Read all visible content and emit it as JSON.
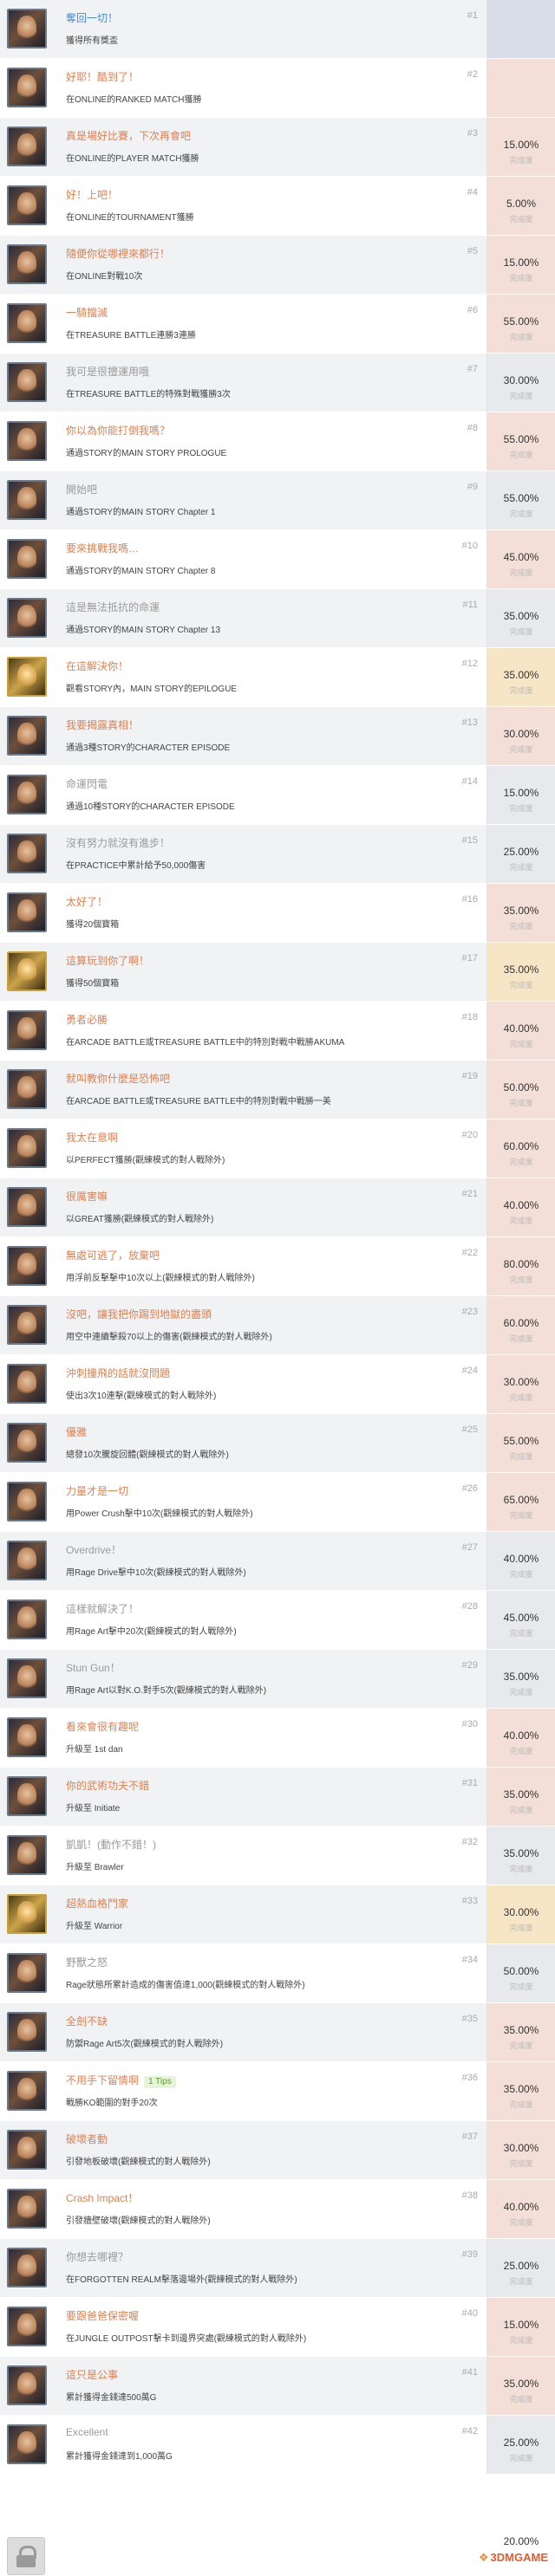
{
  "achievements": [
    {
      "num": "#1",
      "title": "奪回一切！",
      "desc": "獲得所有獎盃",
      "pct": "",
      "lbl": "",
      "tcls": "blue",
      "pcls": "c-blue",
      "gold": false
    },
    {
      "num": "#2",
      "title": "好耶！酷到了！",
      "desc": "在ONLINE的RANKED MATCH獲勝",
      "pct": "",
      "lbl": "",
      "tcls": "",
      "pcls": "c-pink",
      "gold": false
    },
    {
      "num": "#3",
      "title": "真是場好比賽，下次再會吧",
      "desc": "在ONLINE的PLAYER MATCH獲勝",
      "pct": "15.00%",
      "lbl": "完成度",
      "tcls": "",
      "pcls": "c-pink",
      "gold": false
    },
    {
      "num": "#4",
      "title": "好！上吧！",
      "desc": "在ONLINE的TOURNAMENT獲勝",
      "pct": "5.00%",
      "lbl": "完成度",
      "tcls": "",
      "pcls": "c-pink",
      "gold": false
    },
    {
      "num": "#5",
      "title": "隨便你從哪裡來都行！",
      "desc": "在ONLINE對戰10次",
      "pct": "15.00%",
      "lbl": "完成度",
      "tcls": "",
      "pcls": "c-pink",
      "gold": false
    },
    {
      "num": "#6",
      "title": "一騎擋滅",
      "desc": "在TREASURE BATTLE連勝3連勝",
      "pct": "55.00%",
      "lbl": "完成度",
      "tcls": "",
      "pcls": "c-pink",
      "gold": false
    },
    {
      "num": "#7",
      "title": "我可是很擅運用哦",
      "desc": "在TREASURE BATTLE的特殊對戰獲勝3次",
      "pct": "30.00%",
      "lbl": "完成度",
      "tcls": "gray",
      "pcls": "c-gray",
      "gold": false
    },
    {
      "num": "#8",
      "title": "你以為你能打倒我嗎？",
      "desc": "通過STORY的MAIN STORY PROLOGUE",
      "pct": "55.00%",
      "lbl": "完成度",
      "tcls": "",
      "pcls": "c-pink",
      "gold": false
    },
    {
      "num": "#9",
      "title": "開始吧",
      "desc": "通過STORY的MAIN STORY Chapter 1",
      "pct": "55.00%",
      "lbl": "完成度",
      "tcls": "gray",
      "pcls": "c-gray",
      "gold": false
    },
    {
      "num": "#10",
      "title": "要來挑戰我嗎…",
      "desc": "通過STORY的MAIN STORY Chapter 8",
      "pct": "45.00%",
      "lbl": "完成度",
      "tcls": "",
      "pcls": "c-pink",
      "gold": false
    },
    {
      "num": "#11",
      "title": "這是無法抵抗的命運",
      "desc": "通過STORY的MAIN STORY Chapter 13",
      "pct": "35.00%",
      "lbl": "完成度",
      "tcls": "gray",
      "pcls": "c-gray",
      "gold": false
    },
    {
      "num": "#12",
      "title": "在這解決你！",
      "desc": "觀看STORY內，MAIN STORY的EPILOGUE",
      "pct": "35.00%",
      "lbl": "完成度",
      "tcls": "",
      "pcls": "c-cream",
      "gold": true
    },
    {
      "num": "#13",
      "title": "我要揭露真相！",
      "desc": "通過3種STORY的CHARACTER EPISODE",
      "pct": "30.00%",
      "lbl": "完成度",
      "tcls": "",
      "pcls": "c-pink",
      "gold": false
    },
    {
      "num": "#14",
      "title": "命運閃電",
      "desc": "通過10種STORY的CHARACTER EPISODE",
      "pct": "15.00%",
      "lbl": "完成度",
      "tcls": "gray",
      "pcls": "c-gray",
      "gold": false
    },
    {
      "num": "#15",
      "title": "沒有努力就沒有進步！",
      "desc": "在PRACTICE中累計給予50,000傷害",
      "pct": "25.00%",
      "lbl": "完成度",
      "tcls": "gray",
      "pcls": "c-gray",
      "gold": false
    },
    {
      "num": "#16",
      "title": "太好了！",
      "desc": "獲得20個寶箱",
      "pct": "35.00%",
      "lbl": "完成度",
      "tcls": "",
      "pcls": "c-pink",
      "gold": false
    },
    {
      "num": "#17",
      "title": "這算玩到你了啊！",
      "desc": "獲得50個寶箱",
      "pct": "35.00%",
      "lbl": "完成度",
      "tcls": "",
      "pcls": "c-cream",
      "gold": true
    },
    {
      "num": "#18",
      "title": "勇者必勝",
      "desc": "在ARCADE BATTLE或TREASURE BATTLE中的特別對戰中戰勝AKUMA",
      "pct": "40.00%",
      "lbl": "完成度",
      "tcls": "",
      "pcls": "c-pink",
      "gold": false
    },
    {
      "num": "#19",
      "title": "就叫教你什麼是恐怖吧",
      "desc": "在ARCADE BATTLE或TREASURE BATTLE中的特別對戰中戰勝一美",
      "pct": "50.00%",
      "lbl": "完成度",
      "tcls": "",
      "pcls": "c-pink",
      "gold": false
    },
    {
      "num": "#20",
      "title": "我太在意啊",
      "desc": "以PERFECT獲勝(觀練模式的對人戰除外)",
      "pct": "60.00%",
      "lbl": "完成度",
      "tcls": "",
      "pcls": "c-pink",
      "gold": false
    },
    {
      "num": "#21",
      "title": "很厲害嘛",
      "desc": "以GREAT獲勝(觀練模式的對人戰除外)",
      "pct": "40.00%",
      "lbl": "完成度",
      "tcls": "",
      "pcls": "c-pink",
      "gold": false
    },
    {
      "num": "#22",
      "title": "無處可逃了，放棄吧",
      "desc": "用浮前反擊擊中10次以上(觀練模式的對人戰除外)",
      "pct": "80.00%",
      "lbl": "完成度",
      "tcls": "",
      "pcls": "c-pink",
      "gold": false
    },
    {
      "num": "#23",
      "title": "沒吧，讓我把你踢到地獄的盡頭",
      "desc": "用空中連續擊殺70以上的傷害(觀練模式的對人戰除外)",
      "pct": "60.00%",
      "lbl": "完成度",
      "tcls": "",
      "pcls": "c-pink",
      "gold": false
    },
    {
      "num": "#24",
      "title": "沖刺撞飛的話就沒問題",
      "desc": "使出3次10連擊(觀練模式的對人戰除外)",
      "pct": "30.00%",
      "lbl": "完成度",
      "tcls": "",
      "pcls": "c-pink",
      "gold": false
    },
    {
      "num": "#25",
      "title": "優雅",
      "desc": "總發10次騰旋回體(觀練模式的對人戰除外)",
      "pct": "55.00%",
      "lbl": "完成度",
      "tcls": "",
      "pcls": "c-pink",
      "gold": false
    },
    {
      "num": "#26",
      "title": "力量才是一切",
      "desc": "用Power Crush擊中10次(觀練模式的對人戰除外)",
      "pct": "65.00%",
      "lbl": "完成度",
      "tcls": "",
      "pcls": "c-pink",
      "gold": false
    },
    {
      "num": "#27",
      "title": "Overdrive！",
      "desc": "用Rage Drive擊中10次(觀練模式的對人戰除外)",
      "pct": "40.00%",
      "lbl": "完成度",
      "tcls": "gray",
      "pcls": "c-gray",
      "gold": false
    },
    {
      "num": "#28",
      "title": "這樣就解決了！",
      "desc": "用Rage Art擊中20次(觀練模式的對人戰除外)",
      "pct": "45.00%",
      "lbl": "完成度",
      "tcls": "gray",
      "pcls": "c-gray",
      "gold": false
    },
    {
      "num": "#29",
      "title": "Stun Gun！",
      "desc": "用Rage Art以對K.O.對手5次(觀練模式的對人戰除外)",
      "pct": "35.00%",
      "lbl": "完成度",
      "tcls": "gray",
      "pcls": "c-gray",
      "gold": false
    },
    {
      "num": "#30",
      "title": "看來會很有趣呢",
      "desc": "升級至 1st dan",
      "pct": "40.00%",
      "lbl": "完成度",
      "tcls": "",
      "pcls": "c-pink",
      "gold": false
    },
    {
      "num": "#31",
      "title": "你的武術功夫不錯",
      "desc": "升級至 Initiate",
      "pct": "35.00%",
      "lbl": "完成度",
      "tcls": "",
      "pcls": "c-pink",
      "gold": false
    },
    {
      "num": "#32",
      "title": "凱凱！(動作不錯！)",
      "desc": "升級至 Brawler",
      "pct": "35.00%",
      "lbl": "完成度",
      "tcls": "gray",
      "pcls": "c-gray",
      "gold": false
    },
    {
      "num": "#33",
      "title": "超熱血格鬥家",
      "desc": "升級至 Warrior",
      "pct": "30.00%",
      "lbl": "完成度",
      "tcls": "",
      "pcls": "c-cream",
      "gold": true
    },
    {
      "num": "#34",
      "title": "野獸之怒",
      "desc": "Rage狀態所累計造成的傷害值達1,000(觀練模式的對人戰除外)",
      "pct": "50.00%",
      "lbl": "完成度",
      "tcls": "gray",
      "pcls": "c-gray",
      "gold": false
    },
    {
      "num": "#35",
      "title": "全劍不缺",
      "desc": "防禦Rage Art5次(觀練模式的對人戰除外)",
      "pct": "35.00%",
      "lbl": "完成度",
      "tcls": "",
      "pcls": "c-pink",
      "gold": false
    },
    {
      "num": "#36",
      "title": "不用手下留情啊",
      "tag": "1 Tips",
      "desc": "戰勝KO範圍的對手20次",
      "pct": "35.00%",
      "lbl": "完成度",
      "tcls": "",
      "pcls": "c-pink",
      "gold": false
    },
    {
      "num": "#37",
      "title": "破壞者動",
      "desc": "引發地板破壞(觀練模式的對人戰除外)",
      "pct": "30.00%",
      "lbl": "完成度",
      "tcls": "",
      "pcls": "c-pink",
      "gold": false
    },
    {
      "num": "#38",
      "title": "Crash Impact！",
      "desc": "引發牆壁破壞(觀練模式的對人戰除外)",
      "pct": "40.00%",
      "lbl": "完成度",
      "tcls": "",
      "pcls": "c-pink",
      "gold": false
    },
    {
      "num": "#39",
      "title": "你想去哪裡？",
      "desc": "在FORGOTTEN REALM擊落邊場外(觀練模式的對人戰除外)",
      "pct": "25.00%",
      "lbl": "完成度",
      "tcls": "gray",
      "pcls": "c-gray",
      "gold": false
    },
    {
      "num": "#40",
      "title": "要跟爸爸保密喔",
      "desc": "在JUNGLE OUTPOST擊卡到邊界突處(觀練模式的對人戰除外)",
      "pct": "15.00%",
      "lbl": "完成度",
      "tcls": "",
      "pcls": "c-pink",
      "gold": false
    },
    {
      "num": "#41",
      "title": "這只是公事",
      "desc": "累計獲得金錢達500萬G",
      "pct": "35.00%",
      "lbl": "完成度",
      "tcls": "",
      "pcls": "c-pink",
      "gold": false
    },
    {
      "num": "#42",
      "title": "Excellent",
      "desc": "累計獲得金錢達到1,000萬G",
      "pct": "25.00%",
      "lbl": "完成度",
      "tcls": "gray",
      "pcls": "c-gray",
      "gold": false
    }
  ],
  "footer": {
    "pct": "20.00%",
    "watermark": "3DMGAME"
  }
}
